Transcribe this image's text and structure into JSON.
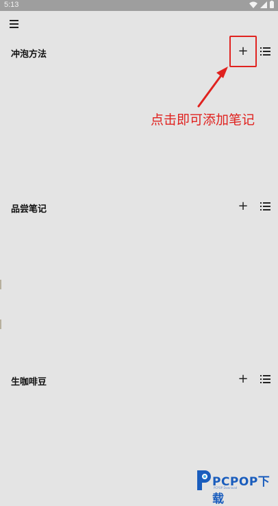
{
  "status_bar": {
    "time": "5:13"
  },
  "toolbar": {
    "menu_icon": "menu-icon"
  },
  "sections": [
    {
      "title": "冲泡方法",
      "add_icon": "plus-icon",
      "list_icon": "list-icon"
    },
    {
      "title": "品尝笔记",
      "add_icon": "plus-icon",
      "list_icon": "list-icon"
    },
    {
      "title": "生咖啡豆",
      "add_icon": "plus-icon",
      "list_icon": "list-icon"
    }
  ],
  "annotation": {
    "text": "点击即可添加笔记",
    "color": "#e0221f"
  },
  "watermark": {
    "text": "PCPOP下载",
    "subtext": "PCPOP Download",
    "color": "#1a5dbd"
  },
  "colors": {
    "background": "#e4e4e4",
    "status_bar": "#9e9e9e"
  }
}
